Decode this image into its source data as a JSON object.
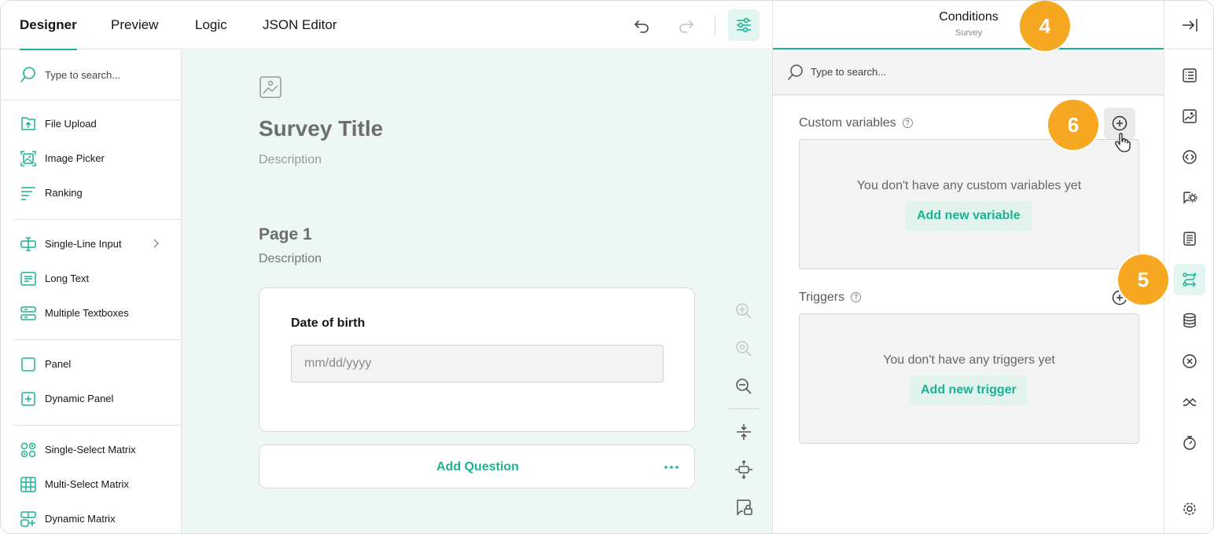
{
  "header": {
    "tabs": [
      {
        "label": "Designer",
        "active": true
      },
      {
        "label": "Preview",
        "active": false
      },
      {
        "label": "Logic",
        "active": false
      },
      {
        "label": "JSON Editor",
        "active": false
      }
    ],
    "icons": [
      "undo-icon",
      "redo-icon",
      "settings-sliders-icon"
    ]
  },
  "toolbox": {
    "search_placeholder": "Type to search...",
    "items": [
      {
        "label": "File Upload",
        "icon": "file-upload-icon"
      },
      {
        "label": "Image Picker",
        "icon": "image-picker-icon"
      },
      {
        "label": "Ranking",
        "icon": "ranking-icon"
      },
      {
        "label": "Single-Line Input",
        "icon": "single-line-input-icon",
        "has_submenu": true
      },
      {
        "label": "Long Text",
        "icon": "long-text-icon"
      },
      {
        "label": "Multiple Textboxes",
        "icon": "multiple-textboxes-icon"
      },
      {
        "label": "Panel",
        "icon": "panel-icon"
      },
      {
        "label": "Dynamic Panel",
        "icon": "dynamic-panel-icon"
      },
      {
        "label": "Single-Select Matrix",
        "icon": "single-select-matrix-icon"
      },
      {
        "label": "Multi-Select Matrix",
        "icon": "multi-select-matrix-icon"
      },
      {
        "label": "Dynamic Matrix",
        "icon": "dynamic-matrix-icon"
      }
    ]
  },
  "canvas": {
    "survey_title": "Survey Title",
    "survey_description": "Description",
    "page_title": "Page 1",
    "page_description": "Description",
    "question": {
      "title": "Date of birth",
      "placeholder": "mm/dd/yyyy"
    },
    "add_question_label": "Add Question"
  },
  "property_grid": {
    "title": "Conditions",
    "subtitle": "Survey",
    "search_placeholder": "Type to search...",
    "sections": {
      "custom_variables": {
        "title": "Custom variables",
        "help": "?",
        "empty_text": "You don't have any custom variables yet",
        "add_button": "Add new variable"
      },
      "triggers": {
        "title": "Triggers",
        "help": "?",
        "empty_text": "You don't have any triggers yet",
        "add_button": "Add new trigger"
      }
    }
  },
  "sidebar": {
    "items": [
      "general-icon",
      "logo-image-icon",
      "navigation-icon",
      "question-settings-icon",
      "pages-icon",
      "conditions-icon",
      "data-icon",
      "validation-icon",
      "quiz-mode-icon",
      "timer-icon",
      "settings-gear-icon"
    ],
    "active": "conditions-icon"
  },
  "badges": {
    "b4": "4",
    "b5": "5",
    "b6": "6"
  },
  "colors": {
    "accent": "#19b394",
    "badge": "#f7a823",
    "accent_light": "#e3f5f0"
  }
}
